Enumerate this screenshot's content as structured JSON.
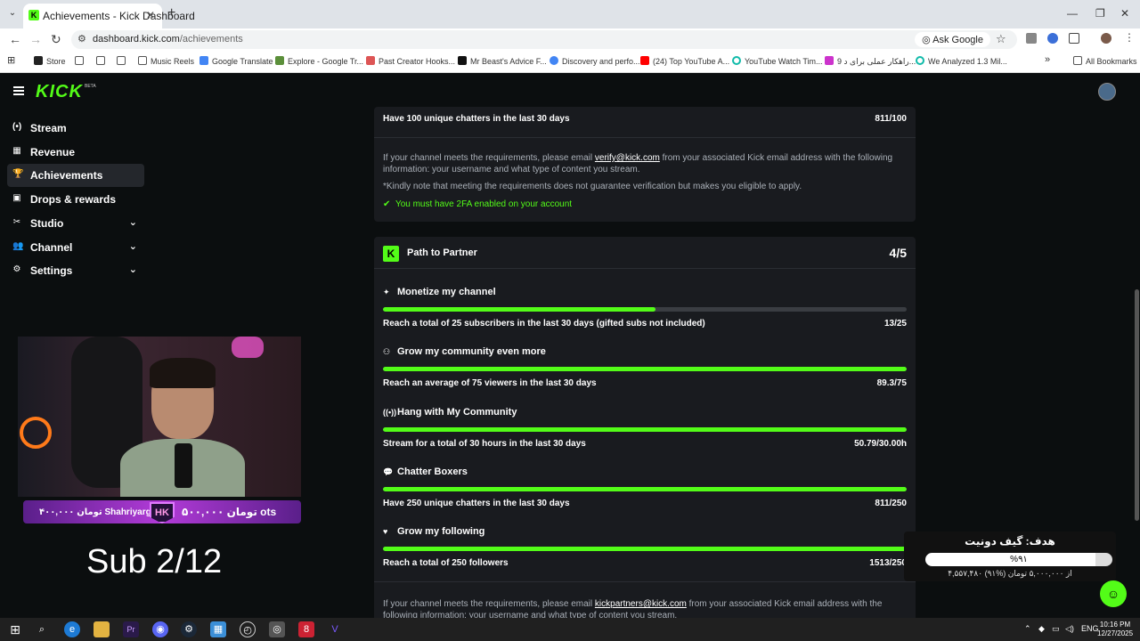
{
  "browser": {
    "tab_title": "Achievements - Kick Dashboard",
    "url_host": "dashboard.kick.com",
    "url_path": "/achievements",
    "ask_google": "Ask Google",
    "bookmarks": [
      "Store",
      "Music Reels",
      "Google Translate",
      "Explore - Google Tr...",
      "Past Creator Hooks...",
      "Mr Beast's Advice F...",
      "Discovery and perfo...",
      "(24) Top YouTube A...",
      "YouTube Watch Tim...",
      "9 راهکار عملی برای د...",
      "We Analyzed 1.3 Mil...",
      "All Bookmarks"
    ]
  },
  "app": {
    "logo": "KICK",
    "beta": "BETA",
    "nav": [
      {
        "icon": "stream-icon",
        "glyph": "(•)",
        "label": "Stream",
        "chevron": false,
        "active": false
      },
      {
        "icon": "revenue-icon",
        "glyph": "▦",
        "label": "Revenue",
        "chevron": false,
        "active": false
      },
      {
        "icon": "trophy-icon",
        "glyph": "🏆",
        "label": "Achievements",
        "chevron": false,
        "active": true
      },
      {
        "icon": "gift-icon",
        "glyph": "▣",
        "label": "Drops & rewards",
        "chevron": false,
        "active": false
      },
      {
        "icon": "studio-icon",
        "glyph": "✂",
        "label": "Studio",
        "chevron": true,
        "active": false
      },
      {
        "icon": "channel-icon",
        "glyph": "👥",
        "label": "Channel",
        "chevron": true,
        "active": false
      },
      {
        "icon": "settings-icon",
        "glyph": "⚙",
        "label": "Settings",
        "chevron": true,
        "active": false
      }
    ]
  },
  "verification": {
    "row_label": "Have 100 unique chatters in the last 30 days",
    "row_value": "811/100",
    "info_pre": "If your channel meets the requirements, please email ",
    "email": "verify@kick.com",
    "info_post": " from your associated Kick email address with the following information: your username and what type of content you stream.",
    "note": "*Kindly note that meeting the requirements does not guarantee verification but makes you eligible to apply.",
    "twofa": "You must have 2FA enabled on your account"
  },
  "partner": {
    "title": "Path to Partner",
    "count": "4/5",
    "sections": [
      {
        "icon": "sparkle-icon",
        "glyph": "✦",
        "heading": "Monetize my channel",
        "label": "Reach a total of 25 subscribers in the last 30 days (gifted subs not included)",
        "value": "13/25",
        "progress": 0.52
      },
      {
        "icon": "community-icon",
        "glyph": "⚇",
        "heading": "Grow my community even more",
        "label": "Reach an average of 75 viewers in the last 30 days",
        "value": "89.3/75",
        "progress": 1
      },
      {
        "icon": "broadcast-icon",
        "glyph": "((•))",
        "heading": "Hang with My Community",
        "label": "Stream for a total of 30 hours in the last 30 days",
        "value": "50.79/30.00h",
        "progress": 1
      },
      {
        "icon": "chat-icon",
        "glyph": "💬",
        "heading": "Chatter Boxers",
        "label": "Have 250 unique chatters in the last 30 days",
        "value": "811/250",
        "progress": 1
      },
      {
        "icon": "heart-icon",
        "glyph": "♥",
        "heading": "Grow my following",
        "label": "Reach a total of 250 followers",
        "value": "1513/250",
        "progress": 1
      }
    ],
    "info_pre": "If your channel meets the requirements, please email ",
    "email": "kickpartners@kick.com",
    "info_post": " from your associated Kick email address with the following information: your username and what type of content you stream."
  },
  "overlay": {
    "banner_left": "۴۰۰,۰۰۰ تومان  Shahriyargoli",
    "banner_badge": "HK",
    "banner_right": "۵۰۰,۰۰۰ تومان  ots",
    "sub_text": "Sub 2/12",
    "donation_title": "هدف: گیف دونیت",
    "donation_percent": "%۹۱",
    "donation_progress": 0.91,
    "donation_sub": "۴,۵۵۷,۴۸۰ از ۵,۰۰۰,۰۰۰ تومان (%۹۱)"
  },
  "taskbar": {
    "lang": "ENG",
    "time": "10:16 PM",
    "date": "12/27/2025"
  },
  "colors": {
    "accent": "#53fc18",
    "card": "#191b1f",
    "background": "#0b0e0f"
  }
}
